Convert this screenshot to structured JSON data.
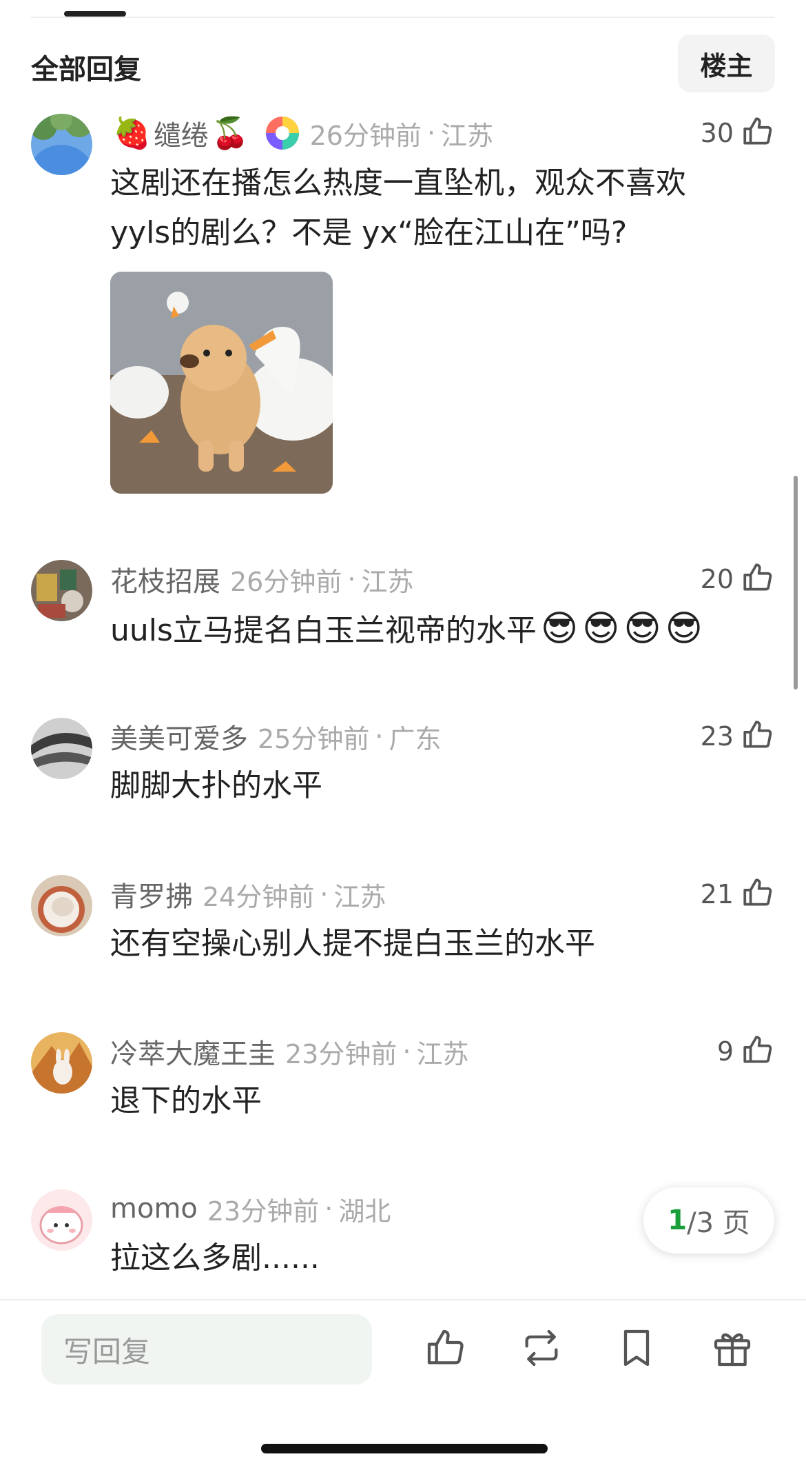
{
  "section": {
    "title": "全部回复",
    "owner_button": "楼主"
  },
  "comments": [
    {
      "username": "缱绻",
      "username_emoji_before": "🍓",
      "username_emoji_after": "🍒",
      "time": "26分钟前",
      "region": "江苏",
      "likes": "30",
      "text_line1": "这剧还在播怎么热度一直坠机，观众不喜欢",
      "text_line2": "yyls的剧么？不是 yx“脸在江山在”吗?",
      "has_photo": true
    },
    {
      "username": "花枝招展",
      "time": "26分钟前",
      "region": "江苏",
      "likes": "20",
      "text": "uuls立马提名白玉兰视帝的水平",
      "emoji": [
        "😎",
        "😎",
        "😎",
        "😎"
      ]
    },
    {
      "username": "美美可爱多",
      "time": "25分钟前",
      "region": "广东",
      "likes": "23",
      "text": "脚脚大扑的水平"
    },
    {
      "username": "青罗拂",
      "time": "24分钟前",
      "region": "江苏",
      "likes": "21",
      "text": "还有空操心别人提不提白玉兰的水平"
    },
    {
      "username": "冷萃大魔王圭",
      "time": "23分钟前",
      "region": "江苏",
      "likes": "9",
      "text": "退下的水平"
    },
    {
      "username": "momo",
      "time": "23分钟前",
      "region": "湖北",
      "text": "拉这么多剧......"
    }
  ],
  "pager": {
    "current": "1",
    "total_label": "/3 页"
  },
  "bottom_bar": {
    "reply_placeholder": "写回复",
    "actions": [
      "like-icon",
      "repost-icon",
      "bookmark-icon",
      "gift-icon"
    ]
  },
  "colors": {
    "accent_green": "#1a9e3a",
    "meta_gray": "#aaaaaa",
    "input_bg": "#f1f5f2"
  }
}
